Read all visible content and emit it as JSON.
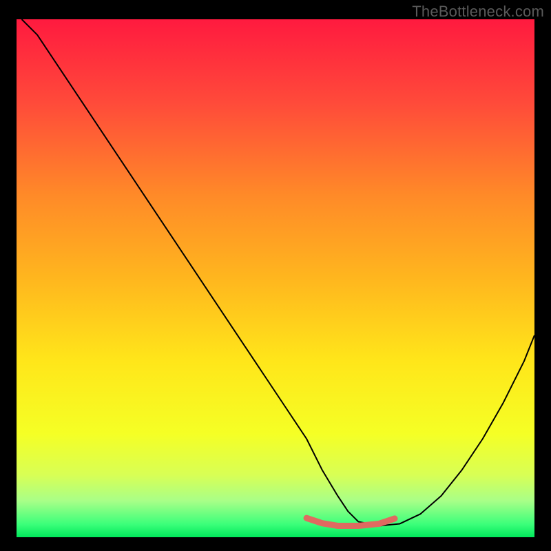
{
  "watermark": "TheBottleneck.com",
  "chart_data": {
    "type": "line",
    "title": "",
    "xlabel": "",
    "ylabel": "",
    "xlim": [
      0,
      100
    ],
    "ylim": [
      0,
      100
    ],
    "grid": false,
    "legend": false,
    "background_gradient_stops": [
      {
        "offset": 0.0,
        "color": "#ff1a3f"
      },
      {
        "offset": 0.16,
        "color": "#ff4a3a"
      },
      {
        "offset": 0.34,
        "color": "#ff8a28"
      },
      {
        "offset": 0.5,
        "color": "#ffb61e"
      },
      {
        "offset": 0.66,
        "color": "#ffe61a"
      },
      {
        "offset": 0.8,
        "color": "#f5ff25"
      },
      {
        "offset": 0.88,
        "color": "#d8ff55"
      },
      {
        "offset": 0.93,
        "color": "#a8ff88"
      },
      {
        "offset": 0.975,
        "color": "#3bff7a"
      },
      {
        "offset": 1.0,
        "color": "#00e85b"
      }
    ],
    "series": [
      {
        "name": "bottleneck-curve",
        "color": "#000000",
        "stroke_width": 2,
        "x": [
          1,
          4,
          8,
          12,
          16,
          20,
          24,
          28,
          32,
          36,
          40,
          44,
          48,
          52,
          56,
          59,
          62,
          64,
          66,
          70,
          74,
          78,
          82,
          86,
          90,
          94,
          98,
          100
        ],
        "y": [
          100,
          97,
          91,
          85,
          79,
          73,
          67,
          61,
          55,
          49,
          43,
          37,
          31,
          25,
          19,
          13,
          8,
          5,
          3,
          2.2,
          2.6,
          4.5,
          8,
          13,
          19,
          26,
          34,
          39
        ]
      },
      {
        "name": "optimal-range-marker",
        "color": "#e06a60",
        "stroke_width": 9,
        "linecap": "round",
        "x": [
          56,
          59,
          62,
          66,
          70,
          73
        ],
        "y": [
          3.7,
          2.7,
          2.2,
          2.2,
          2.6,
          3.6
        ]
      }
    ]
  }
}
